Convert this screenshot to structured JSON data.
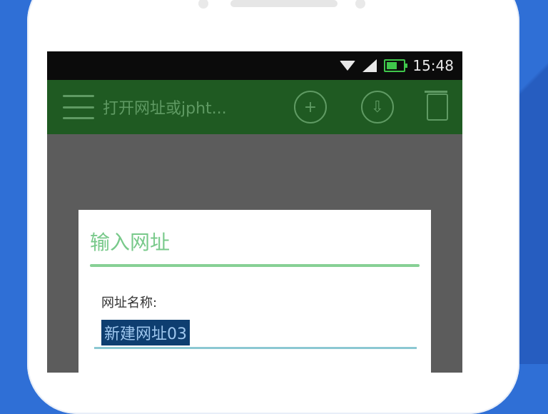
{
  "status": {
    "time": "15:48"
  },
  "toolbar": {
    "title": "打开网址或jpht..."
  },
  "dialog": {
    "title": "输入网址",
    "field_label": "网址名称:",
    "field_value": "新建网址03"
  },
  "colors": {
    "background": "#2f6fd6",
    "toolbar": "#1f5a22",
    "accent": "#78c98a",
    "selection": "#0e3e70"
  },
  "icons": [
    "menu-icon",
    "add-icon",
    "download-icon",
    "trash-icon",
    "wifi-icon",
    "signal-icon",
    "battery-icon"
  ]
}
